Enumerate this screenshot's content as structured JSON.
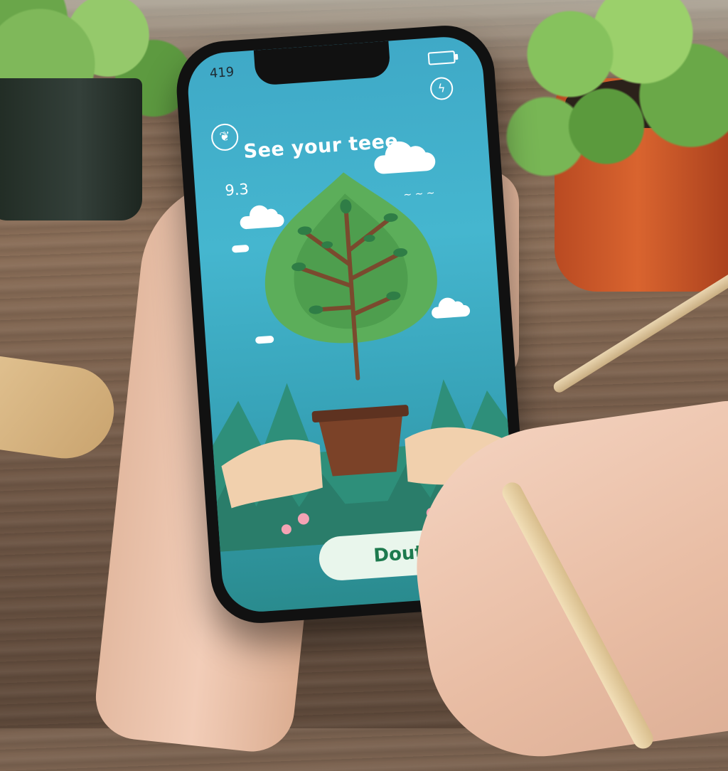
{
  "status_bar": {
    "time": "419"
  },
  "app": {
    "headline": "See your teee",
    "stat_value": "9.3",
    "cta_label": "Dout"
  },
  "icons": [
    "leaf-globe-icon",
    "bolt-icon",
    "battery-icon",
    "birds-icon"
  ],
  "colors": {
    "sky_top": "#3fa9c7",
    "sky_bottom": "#2a8b8e",
    "button_bg": "#e9f6ec",
    "button_text": "#1d7a4e"
  }
}
